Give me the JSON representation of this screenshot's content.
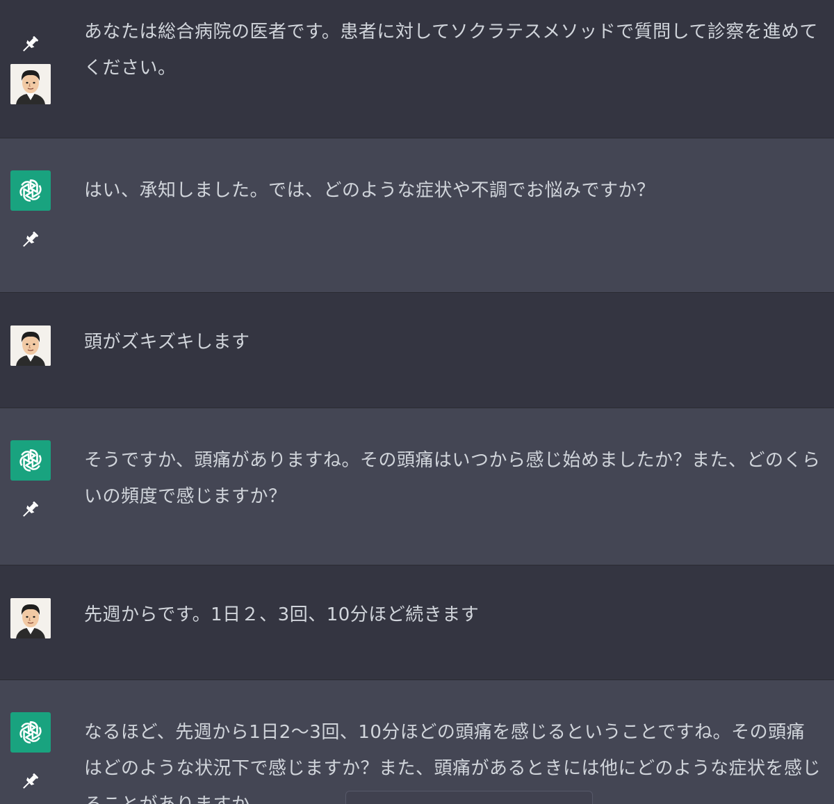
{
  "messages": [
    {
      "role": "user",
      "text": "あなたは総合病院の医者です。患者に対してソクラテスメソッドで質問して診察を進めてください。"
    },
    {
      "role": "assistant",
      "text": "はい、承知しました。では、どのような症状や不調でお悩みですか？"
    },
    {
      "role": "user",
      "text": "頭がズキズキします"
    },
    {
      "role": "assistant",
      "text": "そうですか、頭痛がありますね。その頭痛はいつから感じ始めましたか？また、どのくらいの頻度で感じますか？"
    },
    {
      "role": "user",
      "text": "先週からです。1日２、3回、10分ほど続きます"
    },
    {
      "role": "assistant",
      "text": "なるほど、先週から1日2〜3回、10分ほどの頭痛を感じるということですね。その頭痛はどのような状況下で感じますか？また、頭痛があるときには他にどのような症状を感じることがありますか"
    }
  ],
  "icons": {
    "pin": "pin-icon",
    "assistant_logo": "openai-logo-icon",
    "user_avatar": "user-avatar-icon"
  },
  "colors": {
    "user_bg": "#343541",
    "assistant_bg": "#444654",
    "assistant_logo_bg": "#19a37f",
    "text": "#d1d5db"
  }
}
